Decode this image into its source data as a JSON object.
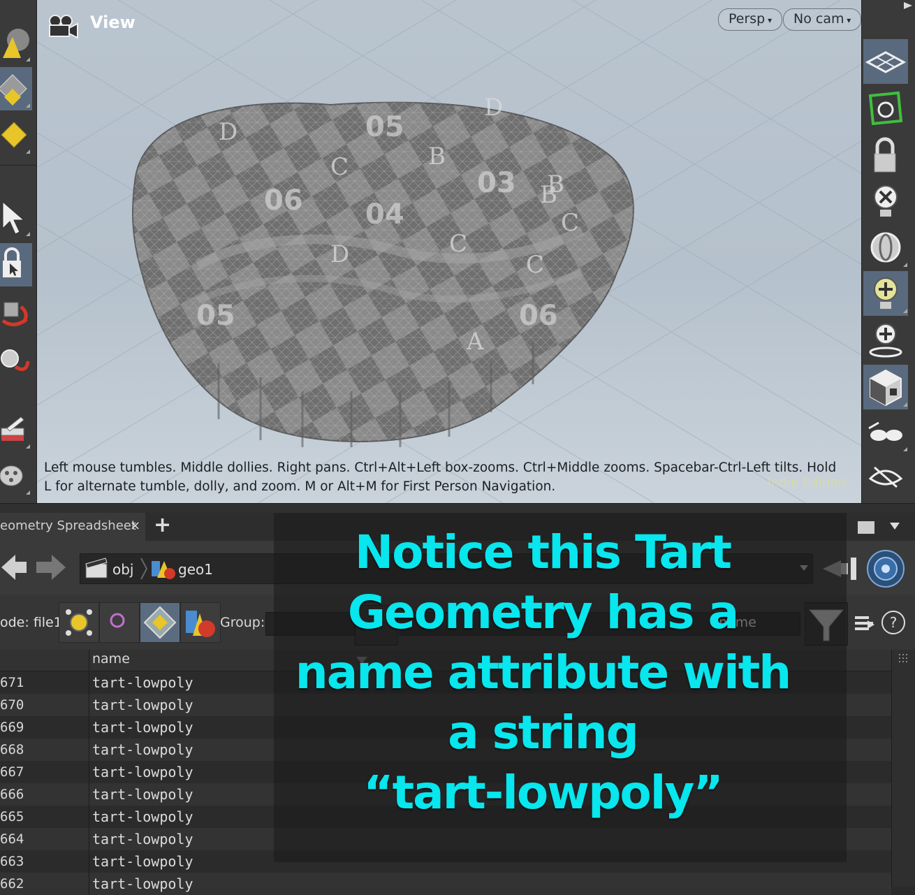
{
  "viewport": {
    "title": "View",
    "projection_label": "Persp",
    "camera_label": "No cam",
    "hint_text": "Left mouse tumbles. Middle dollies. Right pans. Ctrl+Alt+Left box-zooms. Ctrl+Middle zooms. Spacebar-Ctrl-Left tilts. Hold L for alternate tumble, dolly, and zoom. M or Alt+M for First Person Navigation.",
    "edition_label": "Indie Edition",
    "model_letters": [
      "D",
      "C",
      "B",
      "A",
      "C",
      "D",
      "C",
      "B",
      "D",
      "C",
      "B"
    ],
    "model_numbers": [
      "05",
      "06",
      "04",
      "03",
      "05",
      "06"
    ]
  },
  "spreadsheet_tab": {
    "label": "eometry Spreadsheet",
    "close_glyph": "×",
    "add_glyph": "+"
  },
  "path": {
    "root": "obj",
    "node": "geo1"
  },
  "filterbar": {
    "node_label": "ode: file1",
    "group_label": "Group:",
    "attribute_filter_value": "name",
    "help_glyph": "?"
  },
  "spreadsheet": {
    "column_header": "name",
    "rows": [
      {
        "index": "671",
        "name": "tart-lowpoly"
      },
      {
        "index": "670",
        "name": "tart-lowpoly"
      },
      {
        "index": "669",
        "name": "tart-lowpoly"
      },
      {
        "index": "668",
        "name": "tart-lowpoly"
      },
      {
        "index": "667",
        "name": "tart-lowpoly"
      },
      {
        "index": "666",
        "name": "tart-lowpoly"
      },
      {
        "index": "665",
        "name": "tart-lowpoly"
      },
      {
        "index": "664",
        "name": "tart-lowpoly"
      },
      {
        "index": "663",
        "name": "tart-lowpoly"
      },
      {
        "index": "662",
        "name": "tart-lowpoly"
      }
    ]
  },
  "overlay_caption": {
    "line1": "Notice this Tart",
    "line2": "Geometry has a",
    "line3": "name attribute with",
    "line4": "a string",
    "line5": "“tart-lowpoly”"
  },
  "colors": {
    "caption": "#08e6ee",
    "ui_dark": "#2b2b2b",
    "ui_panel": "#3a3a3a",
    "active_button": "#5a6a7e",
    "viewport_bg": "#b9c4cf"
  }
}
